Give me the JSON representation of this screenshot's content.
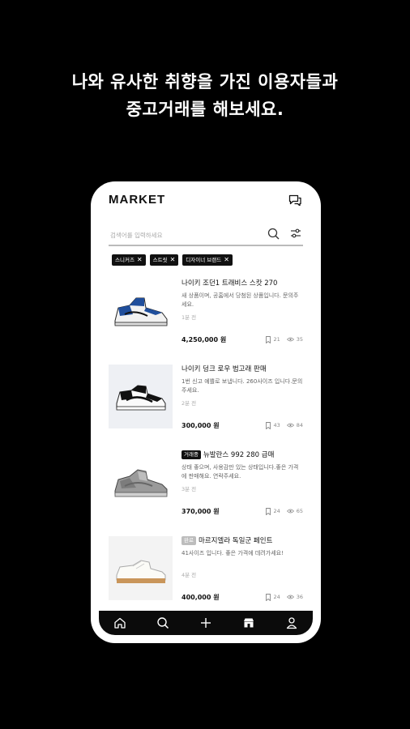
{
  "headline": {
    "line1": "나와 유사한 취향을 가진 이용자들과",
    "line2": "중고거래를 해보세요."
  },
  "app": {
    "brand": "MARKET",
    "search_placeholder": "검색어를 입력하세요"
  },
  "filters": [
    {
      "label": "스니커즈",
      "remove": "✕"
    },
    {
      "label": "스트릿",
      "remove": "✕"
    },
    {
      "label": "디자이너 브랜드",
      "remove": "✕"
    }
  ],
  "items": [
    {
      "badge": "",
      "title": "나이키 조던1 트래비스 스캇 270",
      "desc": "새 상품이며, 공홈에서 당첨된 상품입니다. 문의주세요.",
      "time": "1분 전",
      "price": "4,250,000 원",
      "likes": "21",
      "views": "35"
    },
    {
      "badge": "",
      "title": "나이키 덩크 로우 범고래 판매",
      "desc": "1번 신고 예쁠로 보냅니다. 260사이즈 입니다.문의주세요.",
      "time": "2분 전",
      "price": "300,000 원",
      "likes": "43",
      "views": "84"
    },
    {
      "badge": "거래중",
      "title": "뉴발란스 992 280 급매",
      "desc": "상태 좋으며, 사용감만 있는 상태입니다.좋은 가격에 판매해요. 연락주세요.",
      "time": "3분 전",
      "price": "370,000 원",
      "likes": "24",
      "views": "65"
    },
    {
      "badge": "완료",
      "title": "마르지엘라 독일군 페인트",
      "desc": "41사이즈 입니다. 좋은 가격에 데려가세요!",
      "time": "4분 전",
      "price": "400,000 원",
      "likes": "24",
      "views": "36"
    }
  ],
  "tabs": [
    "home-icon",
    "search-icon",
    "plus-icon",
    "store-icon",
    "profile-icon"
  ]
}
